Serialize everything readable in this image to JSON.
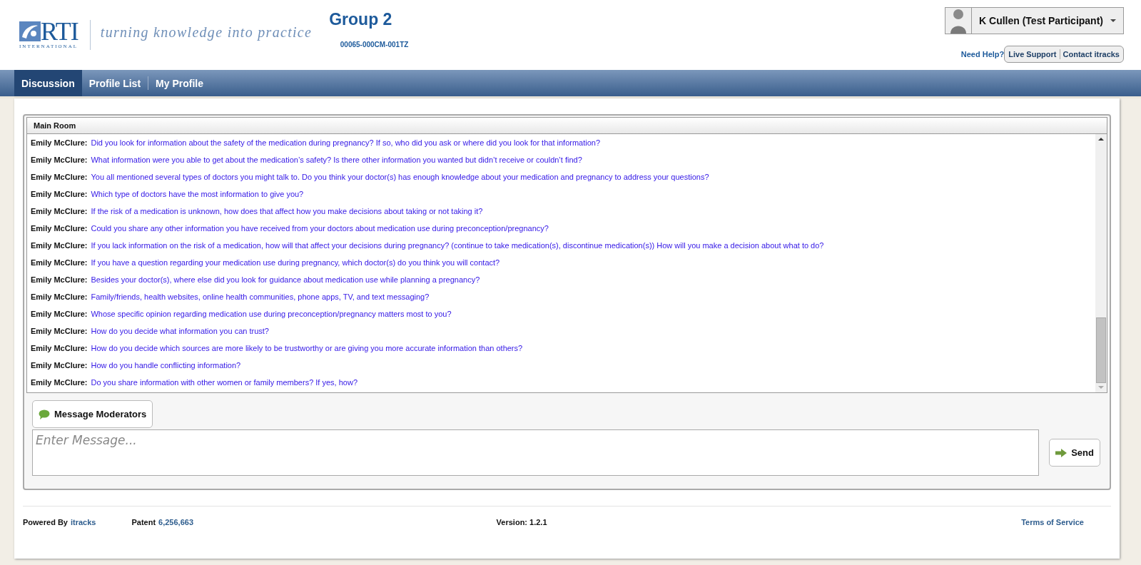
{
  "header": {
    "logo": {
      "wordmark": "RTI",
      "subtitle": "INTERNATIONAL",
      "tagline": "turning knowledge into practice"
    },
    "group_title": "Group 2",
    "group_code": "00065-000CM-001TZ",
    "user_menu": {
      "name": "K Cullen (Test Participant)"
    },
    "help": {
      "label": "Need Help?",
      "links": [
        "Live Support",
        "Contact itracks"
      ]
    }
  },
  "nav_tabs": [
    {
      "label": "Discussion",
      "selected": true
    },
    {
      "label": "Profile List",
      "selected": false
    },
    {
      "label": "My Profile",
      "selected": false
    }
  ],
  "room": {
    "title": "Main Room",
    "messages": [
      {
        "author": "Emily McClure:",
        "text": "Did you look for information about the safety of the medication during pregnancy? If so, who did you ask or where did you look for that information?"
      },
      {
        "author": "Emily McClure:",
        "text": "What information were you able to get about the medication’s safety? Is there other information you wanted but didn’t receive or couldn’t find?"
      },
      {
        "author": "Emily McClure:",
        "text": "You all mentioned several types of doctors you might talk to. Do you think your doctor(s) has enough knowledge about your medication and pregnancy to address your questions?"
      },
      {
        "author": "Emily McClure:",
        "text": "Which type of doctors have the most information to give you?"
      },
      {
        "author": "Emily McClure:",
        "text": "If the risk of a medication is unknown, how does that affect how you make decisions about taking or not taking it?"
      },
      {
        "author": "Emily McClure:",
        "text": "Could you share any other information you have received from your doctors about medication use during preconception/pregnancy?"
      },
      {
        "author": "Emily McClure:",
        "text": "If you lack information on the risk of a medication, how will that affect your decisions during pregnancy? (continue to take medication(s), discontinue medication(s)) How will you make a decision about what to do?"
      },
      {
        "author": "Emily McClure:",
        "text": "If you have a question regarding your medication use during pregnancy, which doctor(s) do you think you will contact?"
      },
      {
        "author": "Emily McClure:",
        "text": "Besides your doctor(s), where else did you look for guidance about medication use while planning a pregnancy?"
      },
      {
        "author": "Emily McClure:",
        "text": "Family/friends, health websites, online health communities, phone apps, TV, and text messaging?"
      },
      {
        "author": "Emily McClure:",
        "text": "Whose specific opinion regarding medication use during preconception/pregnancy matters most to you?"
      },
      {
        "author": "Emily McClure:",
        "text": "How do you decide what information you can trust?"
      },
      {
        "author": "Emily McClure:",
        "text": "How do you decide which sources are more likely to be trustworthy or are giving you more accurate information than others?"
      },
      {
        "author": "Emily McClure:",
        "text": "How do you handle conflicting information?"
      },
      {
        "author": "Emily McClure:",
        "text": "Do you share information with other women or family members? If yes, how?"
      }
    ],
    "moderators_button": "Message Moderators",
    "message_field": {
      "placeholder": "Enter Message..."
    },
    "send_button": "Send"
  },
  "footer": {
    "powered_by": {
      "label": "Powered By",
      "link": "itracks"
    },
    "patent": {
      "label": "Patent",
      "link": "6,256,663"
    },
    "version": "Version: 1.2.1",
    "terms": "Terms of Service"
  }
}
